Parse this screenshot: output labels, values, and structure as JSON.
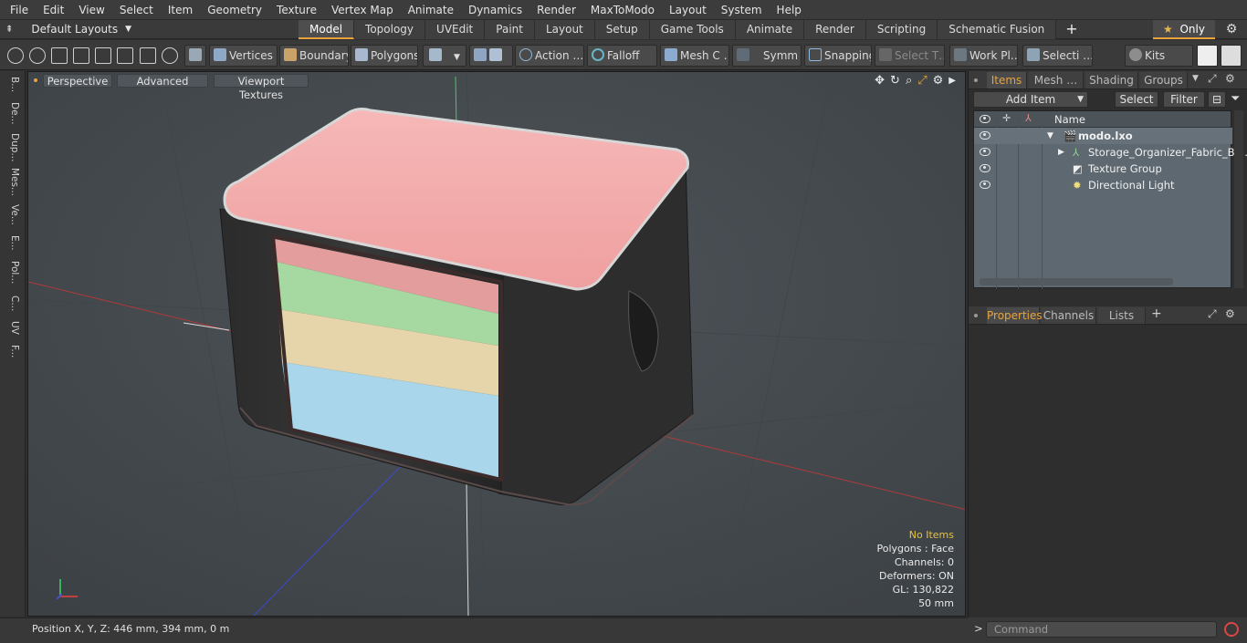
{
  "menu": [
    "File",
    "Edit",
    "View",
    "Select",
    "Item",
    "Geometry",
    "Texture",
    "Vertex Map",
    "Animate",
    "Dynamics",
    "Render",
    "MaxToModo",
    "Layout",
    "System",
    "Help"
  ],
  "layouts_label": "Default Layouts",
  "tabs": [
    "Model",
    "Topology",
    "UVEdit",
    "Paint",
    "Layout",
    "Setup",
    "Game Tools",
    "Animate",
    "Render",
    "Scripting",
    "Schematic Fusion"
  ],
  "active_tab": "Model",
  "only_label": "Only",
  "toolbar": {
    "vertices": "Vertices",
    "boundary": "Boundary",
    "polygons": "Polygons",
    "action": "Action …",
    "falloff": "Falloff",
    "mesh": "Mesh C …",
    "symm": "Symm …",
    "snapping": "Snapping",
    "select_t": "Select T…",
    "workpl": "Work Pl…",
    "selecti": "Selecti …",
    "kits": "Kits"
  },
  "left_tabs": [
    "B...",
    "De...",
    "Dup...",
    "Mes...",
    "Ve...",
    "E...",
    "Pol...",
    "C...",
    "UV",
    "F..."
  ],
  "viewport": {
    "perspective": "Perspective",
    "advanced": "Advanced",
    "viewport_textures": "Viewport Textures",
    "stats": [
      "No Items",
      "Polygons : Face",
      "Channels: 0",
      "Deformers: ON",
      "GL: 130,822",
      "50 mm"
    ],
    "colors": {
      "lid": "#f3aeae",
      "drawer1": "#f0a8a8",
      "drawer2": "#a6d8a1",
      "drawer3": "#e6d4ab",
      "drawer4": "#a9d6ea",
      "box": "#2b2b2b"
    }
  },
  "status": "Position X, Y, Z:  446 mm, 394 mm, 0 m",
  "items_panel": {
    "tabs": [
      "Items",
      "Mesh …",
      "Shading",
      "Groups"
    ],
    "add_item": "Add Item",
    "select": "Select",
    "filter": "Filter",
    "name_header": "Name",
    "rows": [
      "modo.lxo",
      "Storage_Organizer_Fabric_Bl …",
      "Texture Group",
      "Directional Light"
    ]
  },
  "props_panel": {
    "tabs": [
      "Properties",
      "Channels",
      "Lists"
    ]
  },
  "command_placeholder": "Command"
}
